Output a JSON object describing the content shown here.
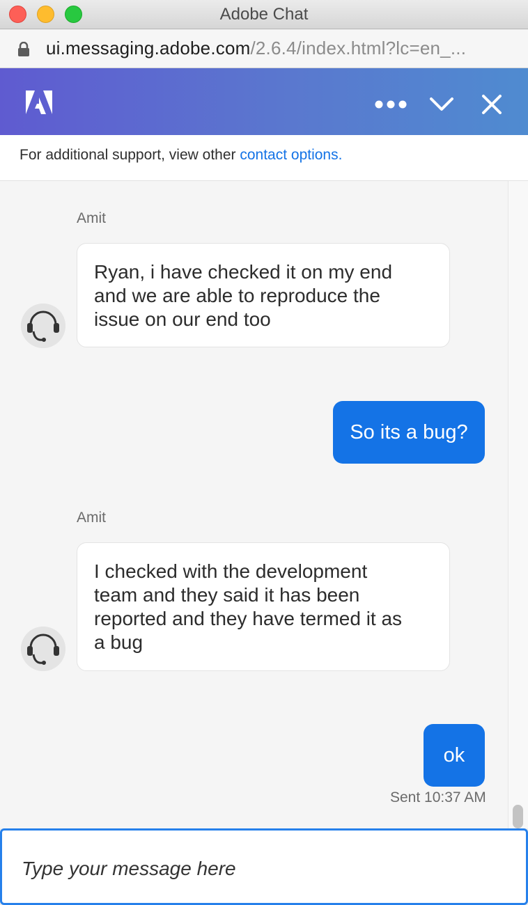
{
  "window": {
    "title": "Adobe Chat",
    "buttons": [
      "close",
      "minimize",
      "zoom"
    ]
  },
  "address_bar": {
    "host": "ui.messaging.adobe.com",
    "path": "/2.6.4/index.html?lc=en_..."
  },
  "header": {
    "logo": "adobe-logo",
    "more_icon": "more-icon",
    "minimize_icon": "chevron-down-icon",
    "close_icon": "close-icon",
    "gradient": [
      "#5f5bd0",
      "#4f8bd0"
    ]
  },
  "support_bar": {
    "text": "For additional support, view other ",
    "link_text": "contact options."
  },
  "messages": [
    {
      "from": "agent",
      "sender": "Amit",
      "avatar": "headset-icon",
      "lines": [
        "Ryan, i have checked it on my end",
        "and we are able to reproduce the",
        "issue on our end too"
      ]
    },
    {
      "from": "user",
      "text": "So its a bug?"
    },
    {
      "from": "agent",
      "sender": "Amit",
      "avatar": "headset-icon",
      "lines": [
        "I checked with the development",
        "team and they said it has been",
        "reported and they have termed it as",
        "a bug"
      ]
    },
    {
      "from": "user",
      "text": "ok",
      "status": "Sent 10:37 AM"
    }
  ],
  "composer": {
    "placeholder": "Type your message here"
  },
  "colors": {
    "accent": "#1473e6",
    "link": "#1473e6",
    "user_bubble": "#1473e6",
    "agent_bubble": "#ffffff"
  }
}
